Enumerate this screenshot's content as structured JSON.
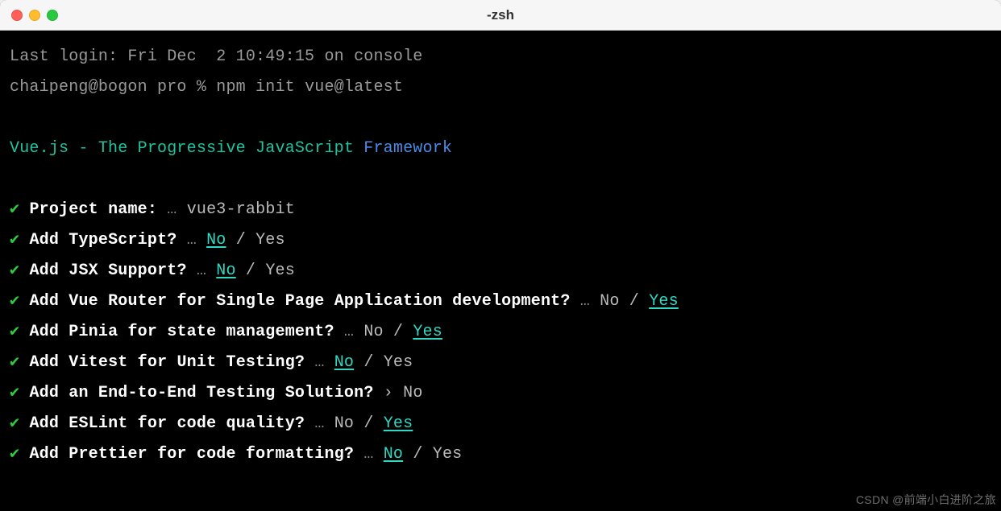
{
  "window": {
    "title": "-zsh"
  },
  "terminal": {
    "last_login": "Last login: Fri Dec  2 10:49:15 on console",
    "prompt": "chaipeng@bogon pro % ",
    "command": "npm init vue@latest",
    "banner_part1": "Vue.js - The Progressive JavaScript",
    "banner_part2": " Framework",
    "ellipsis": "…",
    "slash": " / ",
    "pointer": "›",
    "opt_no": "No",
    "opt_yes": "Yes",
    "check": "✔",
    "prompts": [
      {
        "q": "Project name:",
        "type": "text",
        "answer": "vue3-rabbit"
      },
      {
        "q": "Add TypeScript?",
        "type": "choice",
        "sel": "No"
      },
      {
        "q": "Add JSX Support?",
        "type": "choice",
        "sel": "No"
      },
      {
        "q": "Add Vue Router for Single Page Application development?",
        "type": "choice",
        "sel": "Yes"
      },
      {
        "q": "Add Pinia for state management?",
        "type": "choice",
        "sel": "Yes"
      },
      {
        "q": "Add Vitest for Unit Testing?",
        "type": "choice",
        "sel": "No"
      },
      {
        "q": "Add an End-to-End Testing Solution?",
        "type": "select",
        "answer": "No"
      },
      {
        "q": "Add ESLint for code quality?",
        "type": "choice",
        "sel": "Yes"
      },
      {
        "q": "Add Prettier for code formatting?",
        "type": "choice",
        "sel": "No"
      }
    ]
  },
  "watermark": "CSDN @前端小白进阶之旅"
}
